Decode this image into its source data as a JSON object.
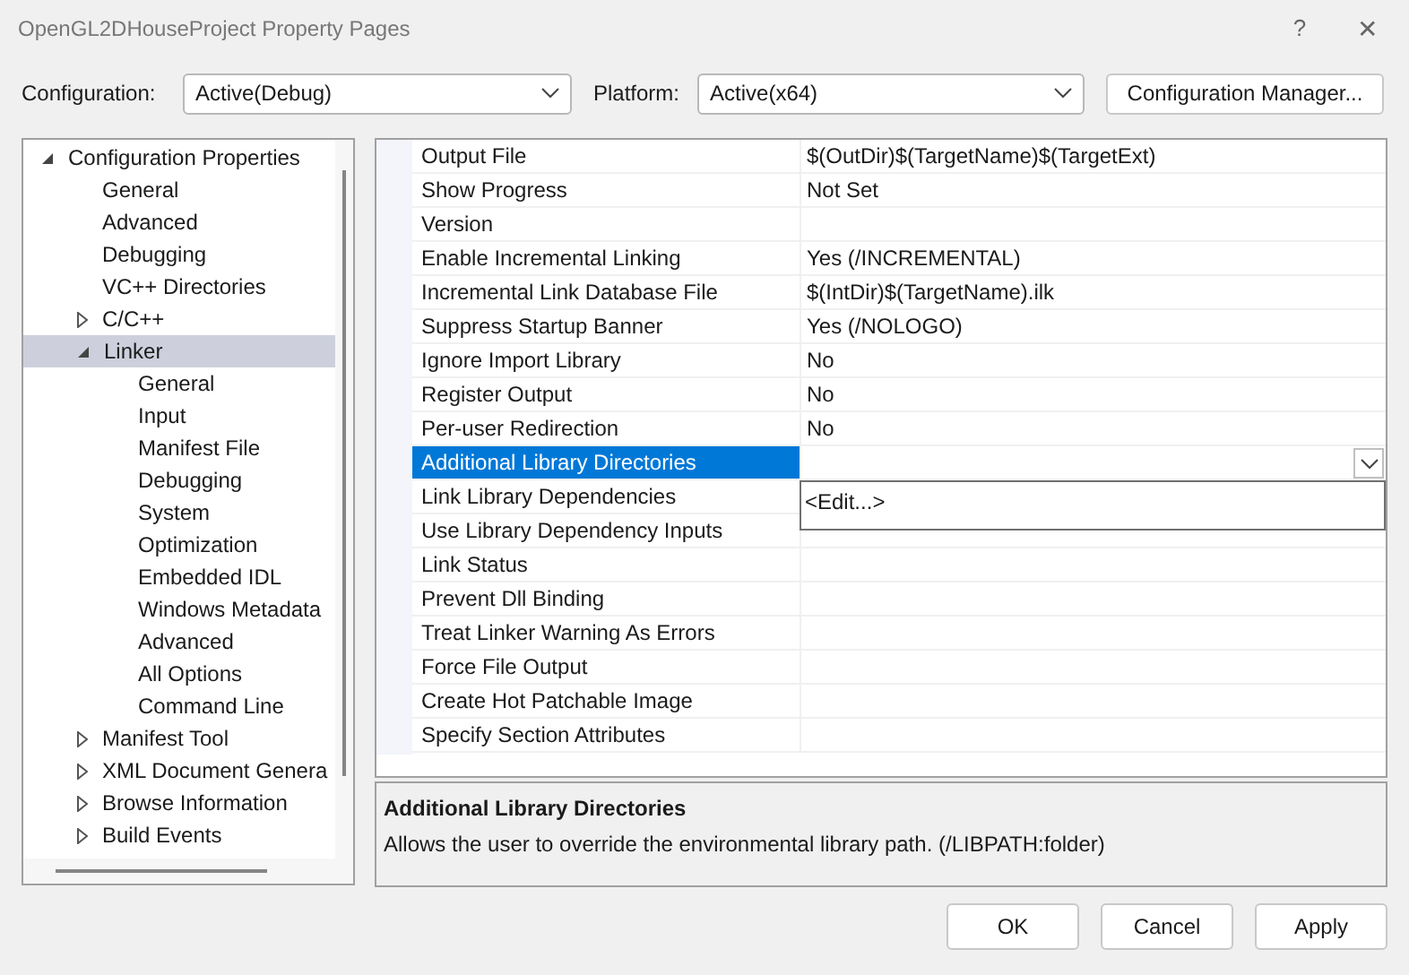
{
  "window": {
    "title": "OpenGL2DHouseProject Property Pages",
    "help": "?",
    "close": "✕"
  },
  "configuration": {
    "label": "Configuration:",
    "value": "Active(Debug)"
  },
  "platform": {
    "label": "Platform:",
    "value": "Active(x64)"
  },
  "configuration_manager": "Configuration Manager...",
  "tree": [
    {
      "label": "Configuration Properties",
      "selected": false,
      "expanded": true,
      "children": [
        {
          "label": "General",
          "selected": false
        },
        {
          "label": "Advanced",
          "selected": false
        },
        {
          "label": "Debugging",
          "selected": false
        },
        {
          "label": "VC++ Directories",
          "selected": false
        },
        {
          "label": "C/C++",
          "selected": false,
          "expanded": false
        },
        {
          "label": "Linker",
          "selected": true,
          "expanded": true,
          "children": [
            {
              "label": "General",
              "selected": false
            },
            {
              "label": "Input",
              "selected": false
            },
            {
              "label": "Manifest File",
              "selected": false
            },
            {
              "label": "Debugging",
              "selected": false
            },
            {
              "label": "System",
              "selected": false
            },
            {
              "label": "Optimization",
              "selected": false
            },
            {
              "label": "Embedded IDL",
              "selected": false
            },
            {
              "label": "Windows Metadata",
              "selected": false
            },
            {
              "label": "Advanced",
              "selected": false
            },
            {
              "label": "All Options",
              "selected": false
            },
            {
              "label": "Command Line",
              "selected": false
            }
          ]
        },
        {
          "label": "Manifest Tool",
          "selected": false,
          "expanded": false
        },
        {
          "label": "XML Document Genera",
          "selected": false,
          "expanded": false
        },
        {
          "label": "Browse Information",
          "selected": false,
          "expanded": false
        },
        {
          "label": "Build Events",
          "selected": false,
          "expanded": false
        }
      ]
    }
  ],
  "properties": [
    {
      "name": "Output File",
      "value": "$(OutDir)$(TargetName)$(TargetExt)",
      "selected": false
    },
    {
      "name": "Show Progress",
      "value": "Not Set",
      "selected": false
    },
    {
      "name": "Version",
      "selected": false
    },
    {
      "name": "Enable Incremental Linking",
      "value": "Yes (/INCREMENTAL)",
      "selected": false
    },
    {
      "name": "Incremental Link Database File",
      "value": "$(IntDir)$(TargetName).ilk",
      "selected": false
    },
    {
      "name": "Suppress Startup Banner",
      "value": "Yes (/NOLOGO)",
      "selected": false
    },
    {
      "name": "Ignore Import Library",
      "value": "No",
      "selected": false
    },
    {
      "name": "Register Output",
      "value": "No",
      "selected": false
    },
    {
      "name": "Per-user Redirection",
      "value": "No",
      "selected": false
    },
    {
      "name": "Additional Library Directories",
      "selected": true
    },
    {
      "name": "Link Library Dependencies",
      "selected": false
    },
    {
      "name": "Use Library Dependency Inputs",
      "selected": false
    },
    {
      "name": "Link Status",
      "selected": false
    },
    {
      "name": "Prevent Dll Binding",
      "selected": false
    },
    {
      "name": "Treat Linker Warning As Errors",
      "selected": false
    },
    {
      "name": "Force File Output",
      "selected": false
    },
    {
      "name": "Create Hot Patchable Image",
      "selected": false
    },
    {
      "name": "Specify Section Attributes",
      "selected": false
    }
  ],
  "open_dropdown": {
    "items": [
      "<Edit...>"
    ]
  },
  "description": {
    "title": "Additional Library Directories",
    "text": "Allows the user to override the environmental library path. (/LIBPATH:folder)"
  },
  "buttons": [
    "OK",
    "Cancel",
    "Apply"
  ]
}
